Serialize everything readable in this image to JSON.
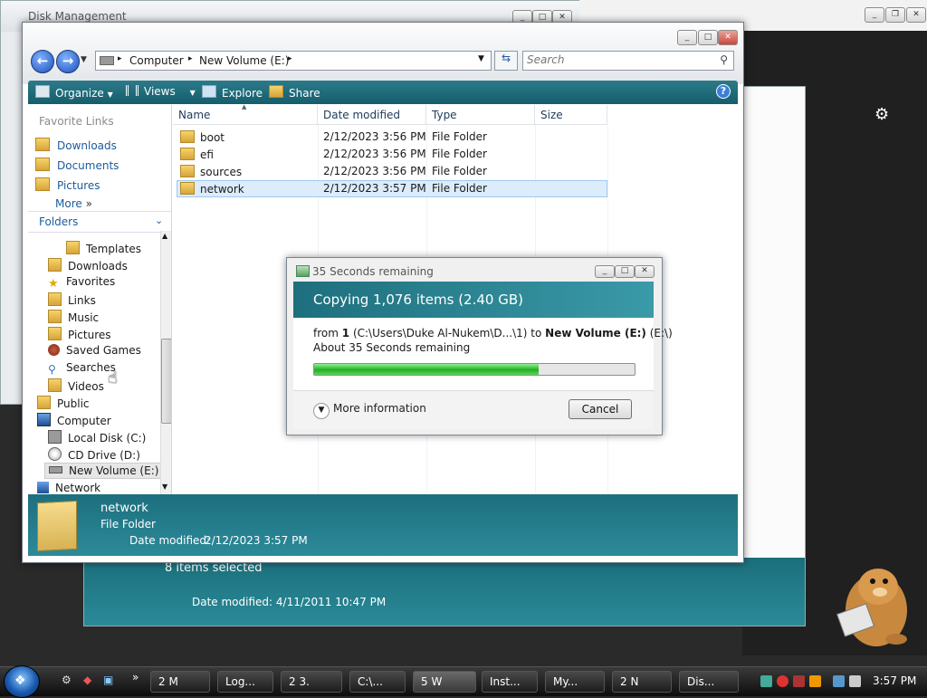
{
  "background": {
    "disk_management_title": "Disk Management",
    "browser_icons": [
      "library-icon",
      "sidebar-icon",
      "menu-icon"
    ],
    "second_explorer": {
      "selection_text": "8 items selected",
      "date_modified": "Date modified: 4/11/2011 10:47 PM"
    }
  },
  "explorer": {
    "breadcrumb": [
      "Computer",
      "New Volume (E:)"
    ],
    "search_placeholder": "Search",
    "toolbar": {
      "organize": "Organize",
      "views": "Views",
      "explore": "Explore",
      "share": "Share"
    },
    "favorite_links": {
      "title": "Favorite Links",
      "items": [
        "Downloads",
        "Documents",
        "Pictures"
      ],
      "more": "More"
    },
    "folders": {
      "title": "Folders",
      "tree": [
        "Templates",
        "Downloads",
        "Favorites",
        "Links",
        "Music",
        "Pictures",
        "Saved Games",
        "Searches",
        "Videos",
        "Public",
        "Computer",
        "Local Disk (C:)",
        "CD Drive (D:)",
        "New Volume (E:)",
        "Network"
      ]
    },
    "columns": [
      "Name",
      "Date modified",
      "Type",
      "Size"
    ],
    "files": [
      {
        "name": "boot",
        "date": "2/12/2023 3:56 PM",
        "type": "File Folder",
        "size": ""
      },
      {
        "name": "efi",
        "date": "2/12/2023 3:56 PM",
        "type": "File Folder",
        "size": ""
      },
      {
        "name": "sources",
        "date": "2/12/2023 3:56 PM",
        "type": "File Folder",
        "size": ""
      },
      {
        "name": "network",
        "date": "2/12/2023 3:57 PM",
        "type": "File Folder",
        "size": ""
      }
    ],
    "details": {
      "name": "network",
      "type": "File Folder",
      "date_label": "Date modified:",
      "date_value": "2/12/2023 3:57 PM"
    }
  },
  "copy_dialog": {
    "title": "35 Seconds remaining",
    "heading": "Copying 1,076 items (2.40 GB)",
    "from_label": "from",
    "from_count": "1",
    "from_path": "(C:\\Users\\Duke Al-Nukem\\D...\\1)",
    "to_label": "to",
    "to_name": "New Volume (E:)",
    "to_path": "(E:\\)",
    "remaining": "About 35 Seconds remaining",
    "progress_percent": 70,
    "more_information": "More information",
    "cancel": "Cancel"
  },
  "taskbar": {
    "tasks": [
      "2 M",
      "Log...",
      "2 3.",
      "C:\\...",
      "5 W",
      "Inst...",
      "My...",
      "2 N",
      "Dis..."
    ],
    "clock": "3:57 PM"
  },
  "colors": {
    "teal_band": "#1d6f7e",
    "progress_green": "#21b021",
    "selection": "#dcecfb"
  }
}
